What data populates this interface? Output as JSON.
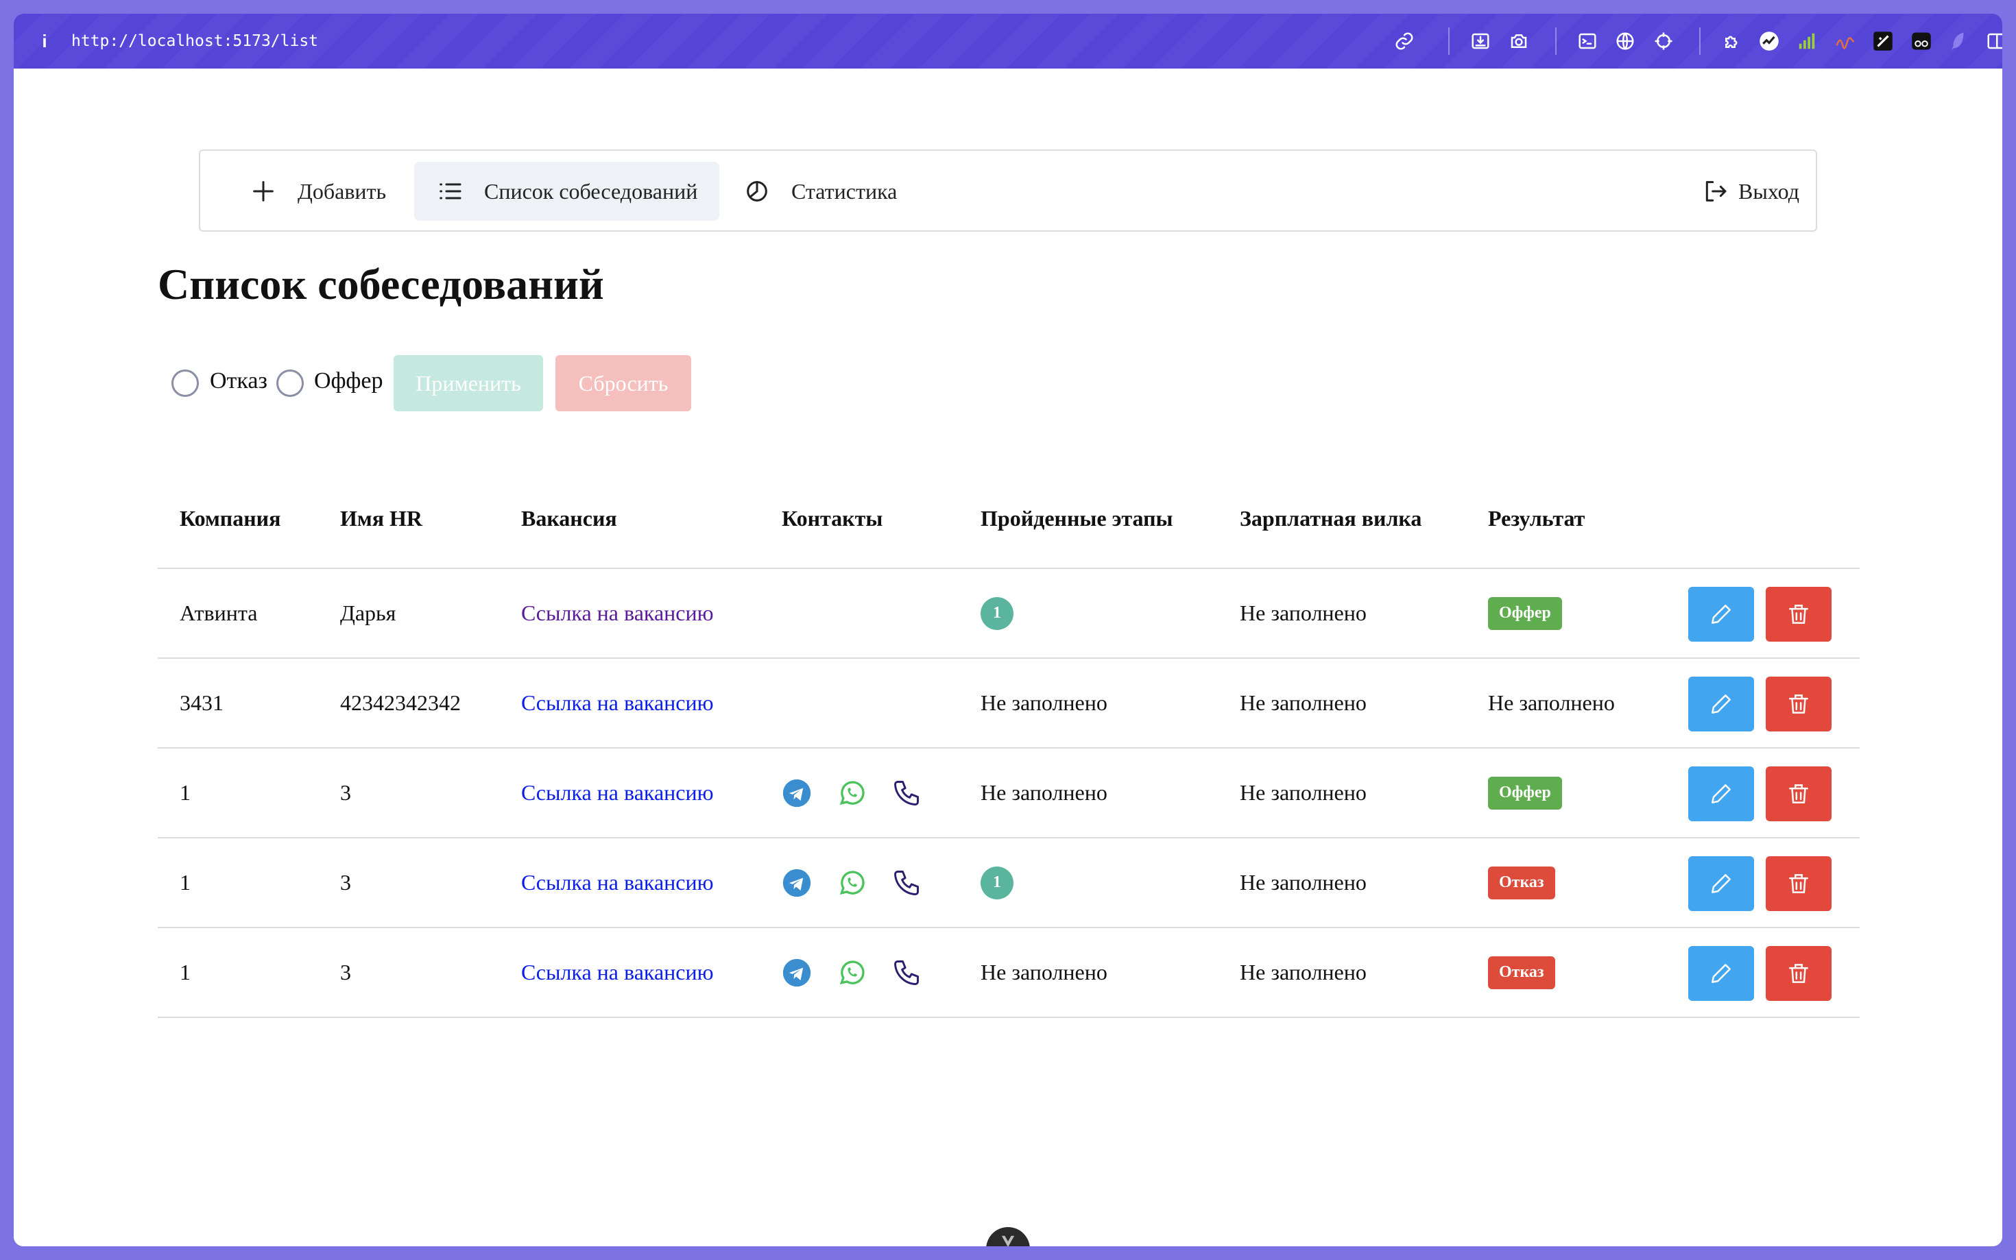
{
  "browser": {
    "info_icon": "i",
    "url": "http://localhost:5173/list"
  },
  "nav": {
    "add_label": "Добавить",
    "list_label": "Список собеседований",
    "stats_label": "Статистика",
    "logout_label": "Выход"
  },
  "page_title": "Список собеседований",
  "filters": {
    "reject_label": "Отказ",
    "offer_label": "Оффер",
    "apply_label": "Применить",
    "reset_label": "Сбросить"
  },
  "table": {
    "headers": [
      "Компания",
      "Имя HR",
      "Вакансия",
      "Контакты",
      "Пройденные этапы",
      "Зарплатная вилка",
      "Результат"
    ],
    "rows": [
      {
        "company": "Атвинта",
        "hr": "Дарья",
        "vacancy": "Ссылка на вакансию",
        "contacts": false,
        "stages": "1",
        "salary": "Не заполнено",
        "result": "Оффер"
      },
      {
        "company": "3431",
        "hr": "42342342342",
        "vacancy": "Ссылка на вакансию",
        "contacts": false,
        "stages": "Не заполнено",
        "salary": "Не заполнено",
        "result": "Не заполнено"
      },
      {
        "company": "1",
        "hr": "3",
        "vacancy": "Ссылка на вакансию",
        "contacts": true,
        "stages": "Не заполнено",
        "salary": "Не заполнено",
        "result": "Оффер"
      },
      {
        "company": "1",
        "hr": "3",
        "vacancy": "Ссылка на вакансию",
        "contacts": true,
        "stages": "1",
        "salary": "Не заполнено",
        "result": "Отказ"
      },
      {
        "company": "1",
        "hr": "3",
        "vacancy": "Ссылка на вакансию",
        "contacts": true,
        "stages": "Не заполнено",
        "salary": "Не заполнено",
        "result": "Отказ"
      }
    ]
  },
  "icons": {
    "toolbar": [
      "link-icon",
      "import-icon",
      "camera-icon",
      "terminal-icon",
      "globe-icon",
      "crosshair-icon",
      "puzzle-icon",
      "graph-icon",
      "signal-icon",
      "wave-icon",
      "ink-icon",
      "glasses-icon",
      "feather-icon",
      "sidebar-icon"
    ],
    "contacts": [
      "telegram-icon",
      "whatsapp-icon",
      "phone-icon"
    ]
  },
  "colors": {
    "browser_bar": "#5545d6",
    "stage_badge": "#5bb49e",
    "offer": "#5fad4e",
    "reject": "#dd4b3b",
    "edit_button": "#42a5f0",
    "delete_button": "#e2483b",
    "link": "#0a1ee6"
  }
}
